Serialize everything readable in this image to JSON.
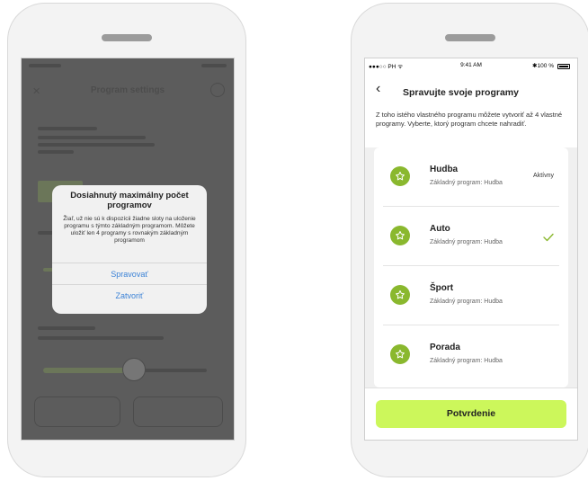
{
  "left_screen": {
    "dim_title": "Program settings",
    "alert": {
      "title": "Dosiahnutý maximálny počet programov",
      "message": "Žiaľ, už nie sú k dispozícii žiadne sloty na uloženie programu s týmto základným programom. Môžete uložiť len 4 programy s rovnakým základným programom",
      "manage_label": "Spravovať",
      "close_label": "Zatvoriť"
    }
  },
  "right_screen": {
    "status": {
      "carrier": "●●●○○ PH ᯤ",
      "time": "9:41 AM",
      "battery": "✱100 %"
    },
    "back_glyph": "‹",
    "title": "Spravujte svoje programy",
    "description": "Z toho istého vlastného programu môžete vytvoriť až 4 vlastné programy. Vyberte, ktorý program chcete nahradiť.",
    "programs": [
      {
        "name": "Hudba",
        "base": "Základný program: Hudba",
        "tag": "Aktívny",
        "selected": false
      },
      {
        "name": "Auto",
        "base": "Základný program: Hudba",
        "tag": "",
        "selected": true
      },
      {
        "name": "Šport",
        "base": "Základný program: Hudba",
        "tag": "",
        "selected": false
      },
      {
        "name": "Porada",
        "base": "Základný program: Hudba",
        "tag": "",
        "selected": false
      }
    ],
    "confirm_label": "Potvrdenie"
  },
  "colors": {
    "accent_green": "#ccf75b",
    "icon_green": "#8ab82e",
    "link_blue": "#3b82d6"
  },
  "icons": {
    "program_icon": "star-icon",
    "selected_icon": "checkmark-icon",
    "back_icon": "chevron-left-icon"
  }
}
